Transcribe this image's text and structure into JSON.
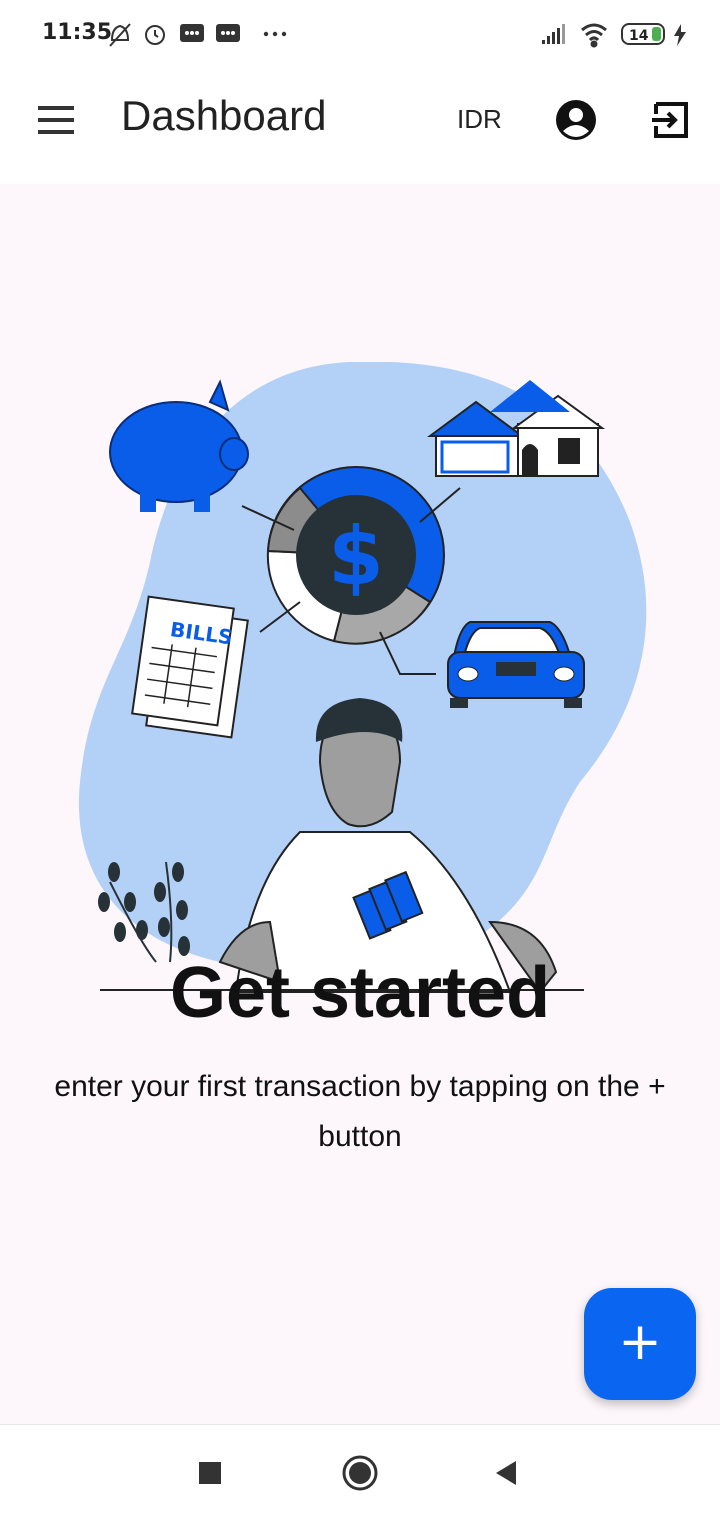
{
  "status_bar": {
    "time": "11:35",
    "battery": "14",
    "left_icons": [
      "silent-icon",
      "alarm-icon",
      "message-icon",
      "message-icon",
      "more-dots-icon"
    ],
    "right_icons": [
      "signal-icon",
      "wifi-icon",
      "battery-icon",
      "charging-icon"
    ]
  },
  "app_bar": {
    "menu_icon": "hamburger-menu-icon",
    "title": "Dashboard",
    "currency": "IDR",
    "account_icon": "account-circle-icon",
    "logout_icon": "logout-icon"
  },
  "empty_state": {
    "illustration_label": "BILLS",
    "headline": "Get started",
    "subtext": "enter your first transaction by tapping on the + button"
  },
  "fab": {
    "label": "+",
    "icon": "add-icon",
    "color": "#0a66f0"
  },
  "nav_bar": {
    "buttons": [
      "recent-apps-icon",
      "home-icon",
      "back-icon"
    ]
  },
  "colors": {
    "accent": "#0a66f0",
    "blob": "#b3d1f7",
    "background": "#fdf7fc"
  }
}
